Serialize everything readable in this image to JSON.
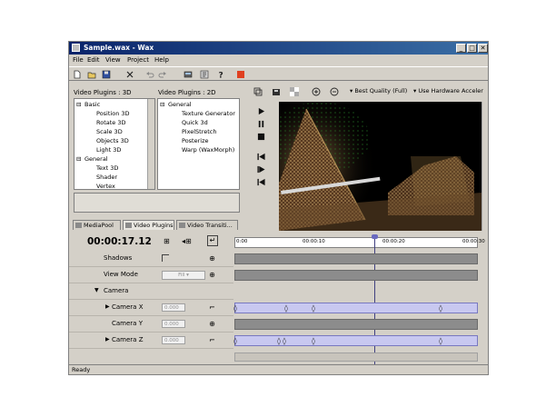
{
  "window": {
    "title": "Sample.wax - Wax",
    "min_label": "_",
    "max_label": "□",
    "close_label": "✕"
  },
  "menu": [
    "File",
    "Edit",
    "View",
    "Project",
    "Help"
  ],
  "toolbar": {
    "icons": [
      "new-file-icon",
      "open-folder-icon",
      "save-icon",
      "cut-icon",
      "undo-icon",
      "redo-icon",
      "render-icon",
      "settings-icon",
      "help-icon",
      "stop-icon"
    ]
  },
  "plugins3d": {
    "label": "Video Plugins : 3D",
    "items": [
      {
        "text": "Basic",
        "level": 0,
        "expander": "⊟"
      },
      {
        "text": "Position 3D",
        "level": 1
      },
      {
        "text": "Rotate 3D",
        "level": 1
      },
      {
        "text": "Scale 3D",
        "level": 1
      },
      {
        "text": "Objects 3D",
        "level": 1
      },
      {
        "text": "Light 3D",
        "level": 1
      },
      {
        "text": "General",
        "level": 0,
        "expander": "⊟"
      },
      {
        "text": "Text 3D",
        "level": 1
      },
      {
        "text": "Shader",
        "level": 1
      },
      {
        "text": "Vertex",
        "level": 1
      }
    ]
  },
  "plugins2d": {
    "label": "Video Plugins : 2D",
    "items": [
      {
        "text": "General",
        "level": 0,
        "expander": "⊟"
      },
      {
        "text": "Texture Generator",
        "level": 1
      },
      {
        "text": "Quick 3d",
        "level": 1
      },
      {
        "text": "PixelStretch",
        "level": 1
      },
      {
        "text": "Posterize",
        "level": 1
      },
      {
        "text": "Warp (WaxMorph)",
        "level": 1
      }
    ]
  },
  "tabs": [
    "MediaPool",
    "Video Plugins",
    "Video Transiti..."
  ],
  "preview": {
    "quality": "Best Quality (Full)",
    "hardware": "Use Hardware Acceler"
  },
  "timeline": {
    "timecode": "00:00:17.12",
    "ruler": [
      "0:00",
      "00:00:10",
      "00:00:20",
      "00:00:30"
    ],
    "rows": [
      {
        "label": "Shadows",
        "control": "checkbox"
      },
      {
        "label": "View Mode",
        "control": "dropdown",
        "value": "Fill"
      },
      {
        "label": "Camera",
        "control": "group",
        "expander": "▼"
      },
      {
        "label": "Camera X",
        "control": "value",
        "value": "0.000",
        "expander": "▶"
      },
      {
        "label": "Camera Y",
        "control": "value",
        "value": "0.000"
      },
      {
        "label": "Camera Z",
        "control": "value",
        "value": "0.000",
        "expander": "▶"
      }
    ]
  },
  "status": "Ready",
  "colors": {
    "title_bar": "#0a246a",
    "track_blue": "#c8c8f0",
    "track_gray": "#8c8c8c",
    "record": "#e04020"
  }
}
